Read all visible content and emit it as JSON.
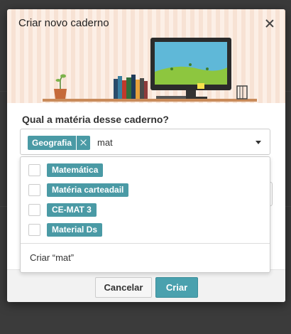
{
  "modal": {
    "title": "Criar novo caderno",
    "close_icon": "close-icon"
  },
  "form": {
    "question": "Qual a matéria desse caderno?",
    "selected_tags": [
      {
        "label": "Geografia"
      }
    ],
    "search_value": "mat",
    "dropdown_icon": "caret-down-icon"
  },
  "dropdown": {
    "options": [
      {
        "label": "Matemática",
        "checked": false
      },
      {
        "label": "Matéria carteadail",
        "checked": false
      },
      {
        "label": "CE-MAT 3",
        "checked": false
      },
      {
        "label": "Material Ds",
        "checked": false
      }
    ],
    "create_label": "Criar “mat”"
  },
  "footer": {
    "cancel_label": "Cancelar",
    "create_label": "Criar"
  },
  "colors": {
    "accent": "#4a9aa5",
    "header_bg": "#fcefe6",
    "overlay": "#3b3b3b"
  }
}
